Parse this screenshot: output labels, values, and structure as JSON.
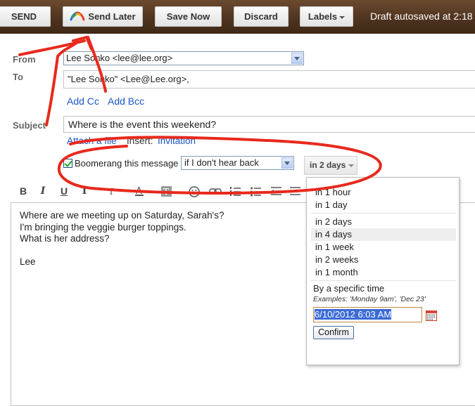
{
  "toolbar": {
    "send": "SEND",
    "send_later": "Send Later",
    "save_now": "Save Now",
    "discard": "Discard",
    "labels": "Labels",
    "autosave_status": "Draft autosaved at 2:18"
  },
  "fields": {
    "from_label": "From",
    "from_value": "Lee Sonko <lee@lee.org>",
    "to_label": "To",
    "to_value": "\"Lee Sonko\" <Lee@Lee.org>,",
    "add_cc": "Add Cc",
    "add_bcc": "Add Bcc",
    "subject_label": "Subject",
    "subject_value": "Where is the event this weekend?",
    "attach": "Attach a file",
    "insert": "Insert:",
    "invitation": "Invitation"
  },
  "boomerang": {
    "checkbox_label": "Boomerang this message",
    "condition": "if I don't hear back",
    "delay_button": "in 2 days"
  },
  "format_bar": {
    "bold": "B",
    "italic": "I",
    "underline": "U",
    "font": "T"
  },
  "body": {
    "lines": [
      "Where are we meeting up on Saturday, Sarah's?",
      "I'm bringing the veggie burger toppings.",
      "What is her address?",
      "",
      "Lee"
    ]
  },
  "dropdown": {
    "options_group1": [
      "in 1 hour",
      "in 1 day"
    ],
    "options_group2": [
      "in 2 days",
      "in 4 days",
      "in 1 week",
      "in 2 weeks",
      "in 1 month"
    ],
    "highlighted": "in 4 days",
    "specific_time_label": "By a specific time",
    "examples": "Examples: 'Monday 9am', 'Dec 23'",
    "date_value": "6/10/2012 6:03 AM",
    "confirm": "Confirm"
  },
  "colors": {
    "toolbar_wood": "#4f3420",
    "link": "#1a56c7",
    "annotation": "#e8291c",
    "highlight": "#3b6bd6"
  }
}
